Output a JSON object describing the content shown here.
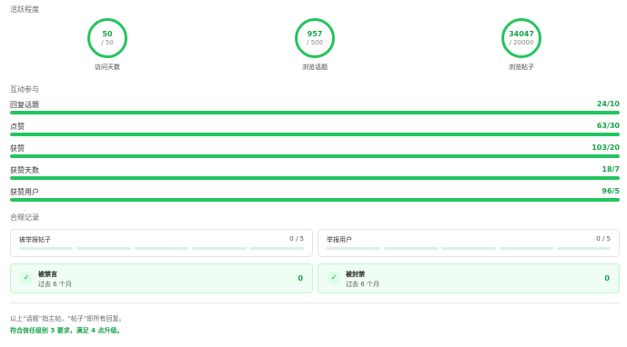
{
  "activity": {
    "title": "活跃程度",
    "circles": [
      {
        "value": "50",
        "total": "/ 50",
        "label": "访问天数"
      },
      {
        "value": "957",
        "total": "/ 500",
        "label": "浏览话题"
      },
      {
        "value": "34047",
        "total": "/ 20000",
        "label": "浏览帖子"
      }
    ]
  },
  "interaction": {
    "title": "互动参与",
    "bars": [
      {
        "label": "回复话题",
        "value": "24/10",
        "progress": 1.0
      },
      {
        "label": "点赞",
        "value": "63/30",
        "progress": 1.0
      },
      {
        "label": "获赞",
        "value": "103/20",
        "progress": 1.0
      },
      {
        "label": "获赞天数",
        "value": "18/7",
        "progress": 1.0
      },
      {
        "label": "获赞用户",
        "value": "96/5",
        "progress": 1.0
      }
    ]
  },
  "compliance": {
    "title": "合规记录",
    "flagged_posts": {
      "label": "被举报帖子",
      "count": "0 / 5"
    },
    "flagged_users": {
      "label": "举报用户",
      "count": "0 / 5"
    },
    "silenced": {
      "title": "被禁言",
      "subtitle": "过去 6 个月",
      "value": "0"
    },
    "suspended": {
      "title": "被封禁",
      "subtitle": "过去 6 个月",
      "value": "0"
    }
  },
  "footnote": "以上“话题”指主帖，“帖子”即所有回复。",
  "requirement": "符合信任级别 3 要求，满足 4 点升级。",
  "colors": {
    "accent": "#22c55e",
    "accent_text": "#16a34a",
    "track": "#dcfce7"
  }
}
